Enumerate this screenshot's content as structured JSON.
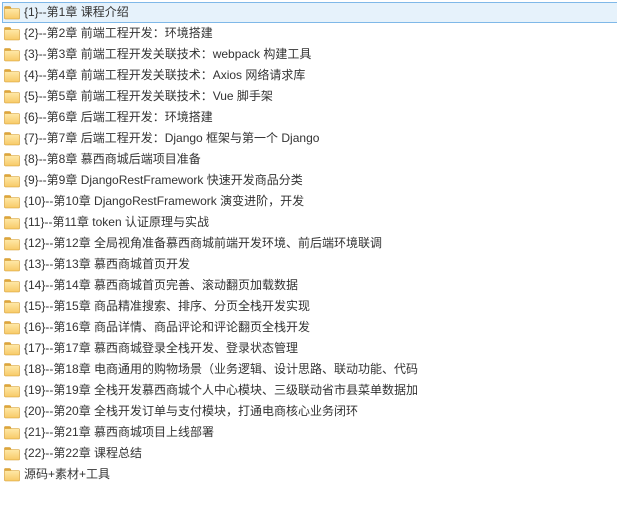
{
  "items": [
    {
      "label": "{1}--第1章 课程介绍",
      "selected": true
    },
    {
      "label": "{2}--第2章 前端工程开发：环境搭建",
      "selected": false
    },
    {
      "label": "{3}--第3章 前端工程开发关联技术：webpack 构建工具",
      "selected": false
    },
    {
      "label": "{4}--第4章 前端工程开发关联技术：Axios 网络请求库",
      "selected": false
    },
    {
      "label": "{5}--第5章 前端工程开发关联技术：Vue 脚手架",
      "selected": false
    },
    {
      "label": "{6}--第6章 后端工程开发：环境搭建",
      "selected": false
    },
    {
      "label": "{7}--第7章 后端工程开发：Django 框架与第一个 Django",
      "selected": false
    },
    {
      "label": "{8}--第8章 慕西商城后端项目准备",
      "selected": false
    },
    {
      "label": "{9}--第9章 DjangoRestFramework 快速开发商品分类",
      "selected": false
    },
    {
      "label": "{10}--第10章 DjangoRestFramework 演变进阶，开发",
      "selected": false
    },
    {
      "label": "{11}--第11章 token 认证原理与实战",
      "selected": false
    },
    {
      "label": "{12}--第12章 全局视角准备慕西商城前端开发环境、前后端环境联调",
      "selected": false
    },
    {
      "label": "{13}--第13章 慕西商城首页开发",
      "selected": false
    },
    {
      "label": "{14}--第14章 慕西商城首页完善、滚动翻页加载数据",
      "selected": false
    },
    {
      "label": "{15}--第15章 商品精准搜索、排序、分页全栈开发实现",
      "selected": false
    },
    {
      "label": "{16}--第16章 商品详情、商品评论和评论翻页全栈开发",
      "selected": false
    },
    {
      "label": "{17}--第17章 慕西商城登录全栈开发、登录状态管理",
      "selected": false
    },
    {
      "label": "{18}--第18章 电商通用的购物场景（业务逻辑、设计思路、联动功能、代码",
      "selected": false
    },
    {
      "label": "{19}--第19章 全栈开发慕西商城个人中心模块、三级联动省市县菜单数据加",
      "selected": false
    },
    {
      "label": "{20}--第20章 全栈开发订单与支付模块，打通电商核心业务闭环",
      "selected": false
    },
    {
      "label": "{21}--第21章 慕西商城项目上线部署",
      "selected": false
    },
    {
      "label": "{22}--第22章 课程总结",
      "selected": false
    },
    {
      "label": "源码+素材+工具",
      "selected": false
    }
  ],
  "folderColors": {
    "tab": "#e0a538",
    "body1": "#ffe9a8",
    "body2": "#f7c967",
    "stroke": "#d29a2e"
  }
}
